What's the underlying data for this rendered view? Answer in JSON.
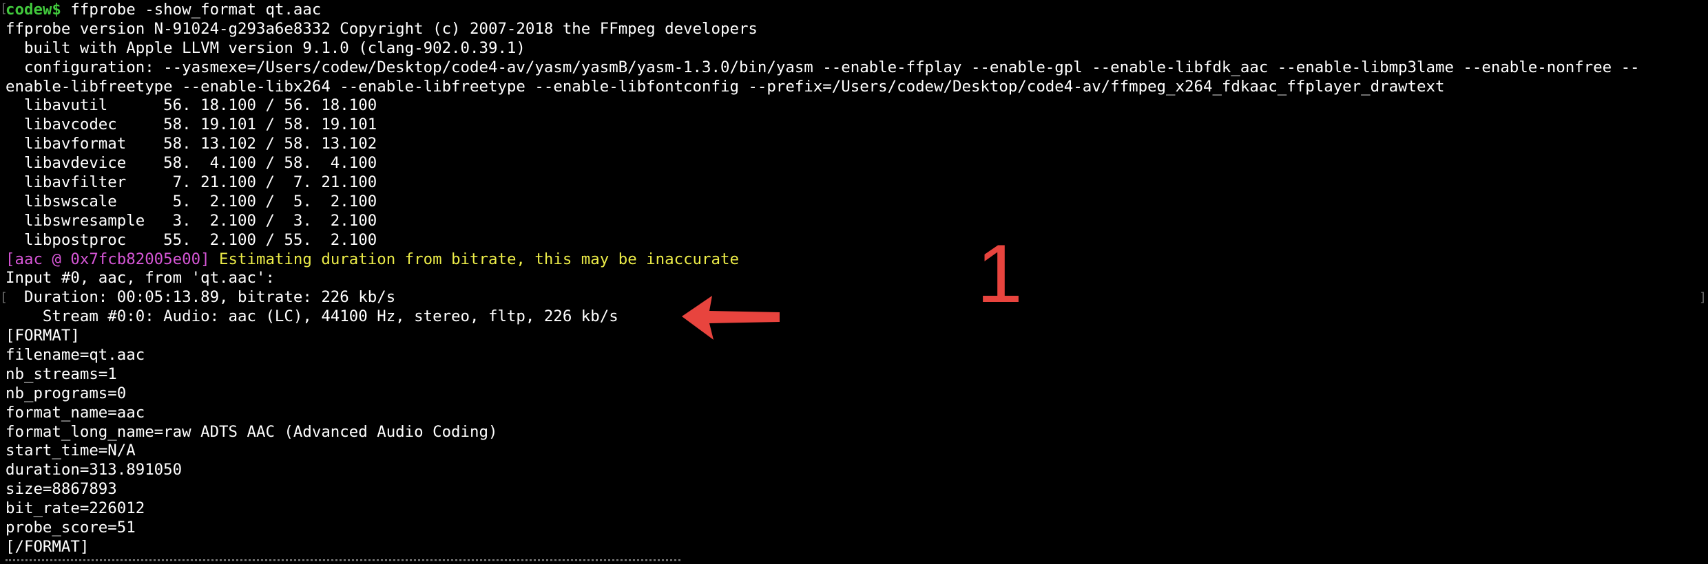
{
  "terminal": {
    "prompt_user": "codew$",
    "command": " ffprobe -show_format qt.aac",
    "lines": [
      "ffprobe version N-91024-g293a6e8332 Copyright (c) 2007-2018 the FFmpeg developers",
      "  built with Apple LLVM version 9.1.0 (clang-902.0.39.1)",
      "  configuration: --yasmexe=/Users/codew/Desktop/code4-av/yasm/yasmB/yasm-1.3.0/bin/yasm --enable-ffplay --enable-gpl --enable-libfdk_aac --enable-libmp3lame --enable-nonfree --",
      "enable-libfreetype --enable-libx264 --enable-libfreetype --enable-libfontconfig --prefix=/Users/codew/Desktop/code4-av/ffmpeg_x264_fdkaac_ffplayer_drawtext",
      "  libavutil      56. 18.100 / 56. 18.100",
      "  libavcodec     58. 19.101 / 58. 19.101",
      "  libavformat    58. 13.102 / 58. 13.102",
      "  libavdevice    58.  4.100 / 58.  4.100",
      "  libavfilter     7. 21.100 /  7. 21.100",
      "  libswscale      5.  2.100 /  5.  2.100",
      "  libswresample   3.  2.100 /  3.  2.100",
      "  libpostproc    55.  2.100 / 55.  2.100"
    ],
    "warning_tag": "[aac @ 0x7fcb82005e00]",
    "warning_text": " Estimating duration from bitrate, this may be inaccurate",
    "input_lines": [
      "Input #0, aac, from 'qt.aac':",
      "  Duration: 00:05:13.89, bitrate: 226 kb/s",
      "    Stream #0:0: Audio: aac (LC), 44100 Hz, stereo, fltp, 226 kb/s"
    ],
    "format_lines": [
      "[FORMAT]",
      "filename=qt.aac",
      "nb_streams=1",
      "nb_programs=0",
      "format_name=aac",
      "format_long_name=raw ADTS AAC (Advanced Audio Coding)",
      "start_time=N/A",
      "duration=313.891050",
      "size=8867893",
      "bit_rate=226012",
      "probe_score=51",
      "[/FORMAT]"
    ]
  },
  "annotation": {
    "number": "1",
    "color": "#e8443e"
  },
  "colors": {
    "background": "#000000",
    "prompt": "#41c83c",
    "text": "#ffffff",
    "tag": "#d656d6",
    "warning": "#ecec48"
  }
}
